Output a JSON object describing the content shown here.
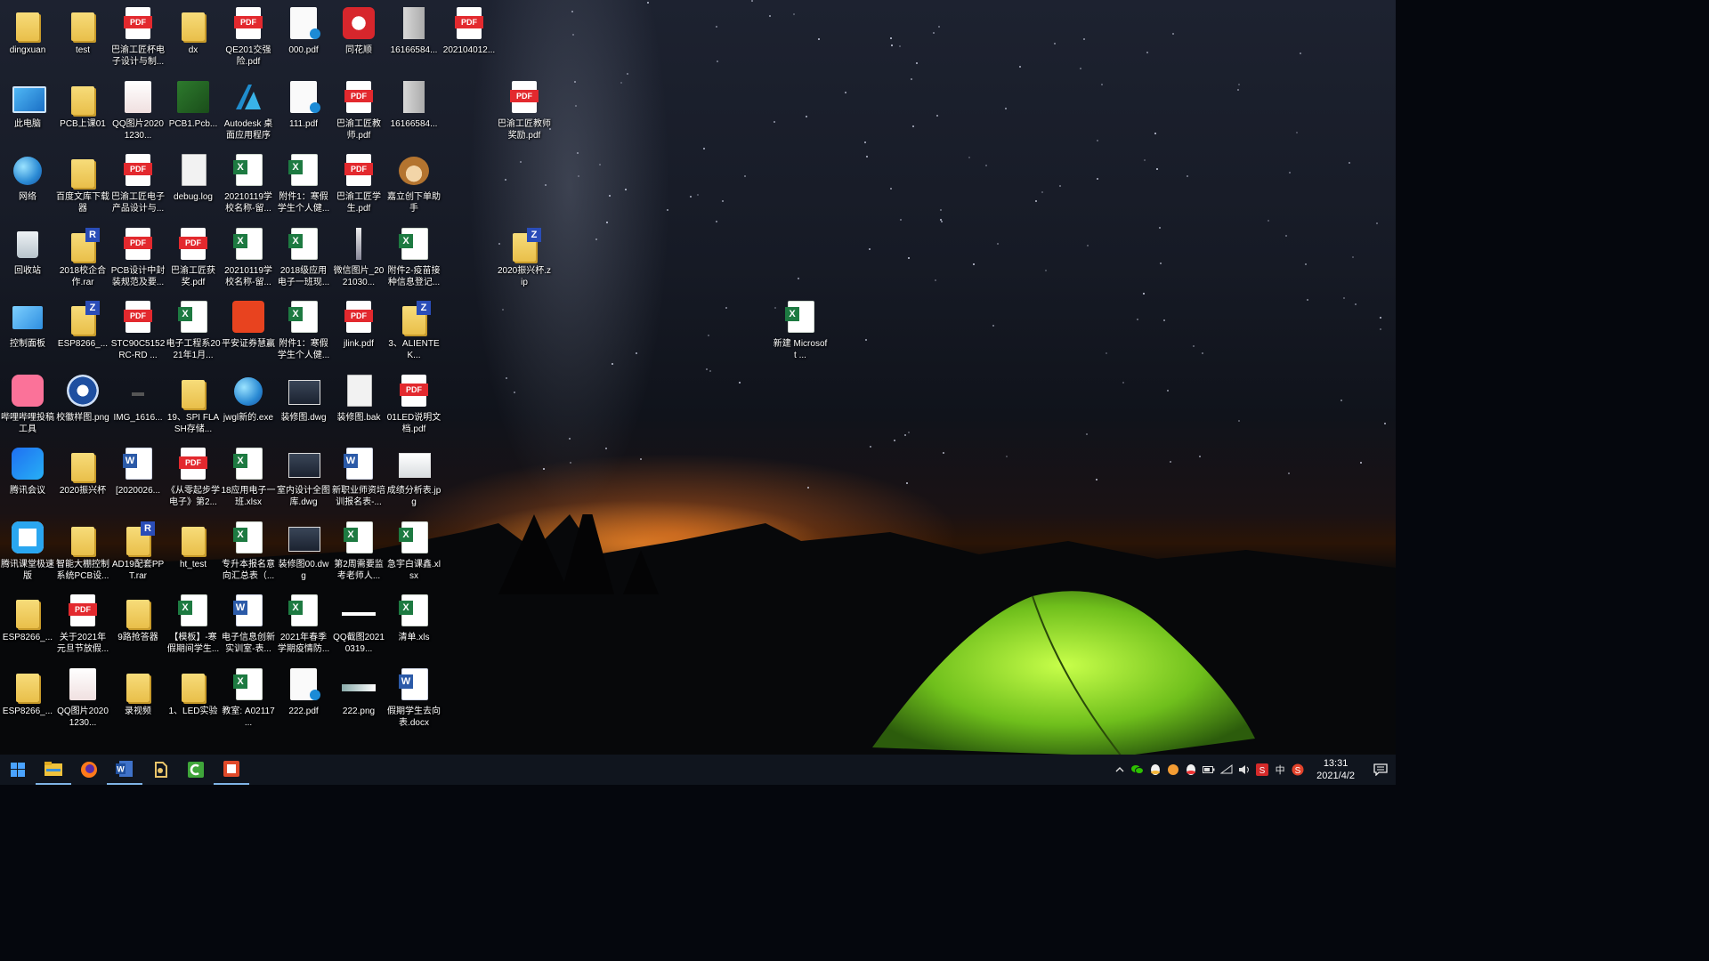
{
  "desktop": {
    "icons": [
      {
        "label": "dingxuan",
        "type": "user-folder",
        "icon": "user-folder-icon",
        "col": 0,
        "row": 0
      },
      {
        "label": "test",
        "type": "folder",
        "icon": "folder-icon",
        "col": 1,
        "row": 0
      },
      {
        "label": "巴渝工匠杯电子设计与制...",
        "type": "pdf",
        "icon": "pdf-icon",
        "col": 2,
        "row": 0
      },
      {
        "label": "dx",
        "type": "folder",
        "icon": "folder-icon",
        "col": 3,
        "row": 0
      },
      {
        "label": "QE201交强险.pdf",
        "type": "pdf",
        "icon": "pdf-icon",
        "col": 4,
        "row": 0
      },
      {
        "label": "000.pdf",
        "type": "edge-pdf",
        "icon": "edge-pdf-icon",
        "col": 5,
        "row": 0
      },
      {
        "label": "同花顺",
        "type": "app-red",
        "icon": "tonghuashun-icon",
        "col": 6,
        "row": 0
      },
      {
        "label": "16166584...",
        "type": "tall",
        "icon": "image-file-icon",
        "col": 7,
        "row": 0
      },
      {
        "label": "202104012...",
        "type": "pdf",
        "icon": "pdf-icon",
        "col": 8,
        "row": 0
      },
      {
        "label": "此电脑",
        "type": "pc",
        "icon": "this-pc-icon",
        "col": 0,
        "row": 1
      },
      {
        "label": "PCB上课01",
        "type": "folder",
        "icon": "folder-icon",
        "col": 1,
        "row": 1
      },
      {
        "label": "QQ图片20201230...",
        "type": "img-doc",
        "icon": "image-icon",
        "col": 2,
        "row": 1
      },
      {
        "label": "PCB1.Pcb...",
        "type": "pcb",
        "icon": "pcb-icon",
        "col": 3,
        "row": 1
      },
      {
        "label": "Autodesk 桌面应用程序",
        "type": "autodesk",
        "icon": "autodesk-icon",
        "col": 4,
        "row": 1
      },
      {
        "label": "111.pdf",
        "type": "edge-pdf",
        "icon": "edge-pdf-icon",
        "col": 5,
        "row": 1
      },
      {
        "label": "巴渝工匠教师.pdf",
        "type": "pdf",
        "icon": "pdf-icon",
        "col": 6,
        "row": 1
      },
      {
        "label": "16166584...",
        "type": "tall",
        "icon": "image-file-icon",
        "col": 7,
        "row": 1
      },
      {
        "label": "巴渝工匠教师奖励.pdf",
        "type": "pdf",
        "icon": "pdf-icon",
        "col": 9,
        "row": 1
      },
      {
        "label": "网络",
        "type": "globe",
        "icon": "network-icon",
        "col": 0,
        "row": 2
      },
      {
        "label": "百度文库下载器",
        "type": "folder",
        "icon": "folder-icon",
        "col": 1,
        "row": 2
      },
      {
        "label": "巴渝工匠电子产品设计与...",
        "type": "pdf",
        "icon": "pdf-icon",
        "col": 2,
        "row": 2
      },
      {
        "label": "debug.log",
        "type": "file",
        "icon": "text-file-icon",
        "col": 3,
        "row": 2
      },
      {
        "label": "20210119学校名称-留...",
        "type": "xls",
        "icon": "excel-icon",
        "col": 4,
        "row": 2
      },
      {
        "label": "附件1：寒假学生个人健...",
        "type": "xls",
        "icon": "excel-icon",
        "col": 5,
        "row": 2
      },
      {
        "label": "巴渝工匠学生.pdf",
        "type": "pdf",
        "icon": "pdf-icon",
        "col": 6,
        "row": 2
      },
      {
        "label": "嘉立创下单助手",
        "type": "bear",
        "icon": "jlc-bear-icon",
        "col": 7,
        "row": 2
      },
      {
        "label": "回收站",
        "type": "bin",
        "icon": "recycle-bin-icon",
        "col": 0,
        "row": 3
      },
      {
        "label": "2018校企合作.rar",
        "type": "rar",
        "icon": "rar-icon",
        "col": 1,
        "row": 3
      },
      {
        "label": "PCB设计中封装规范及要...",
        "type": "pdf",
        "icon": "pdf-icon",
        "col": 2,
        "row": 3
      },
      {
        "label": "巴渝工匠获奖.pdf",
        "type": "pdf",
        "icon": "pdf-icon",
        "col": 3,
        "row": 3
      },
      {
        "label": "20210119学校名称-留...",
        "type": "xls",
        "icon": "excel-icon",
        "col": 4,
        "row": 3
      },
      {
        "label": "2018级应用电子一班现...",
        "type": "xls",
        "icon": "excel-icon",
        "col": 5,
        "row": 3
      },
      {
        "label": "微信图片_2021030...",
        "type": "img-thin",
        "icon": "image-icon",
        "col": 6,
        "row": 3
      },
      {
        "label": "附件2-疫苗接种信息登记...",
        "type": "xls",
        "icon": "excel-icon",
        "col": 7,
        "row": 3
      },
      {
        "label": "2020振兴杯.zip",
        "type": "zip",
        "icon": "zip-icon",
        "col": 9,
        "row": 3
      },
      {
        "label": "控制面板",
        "type": "ctrl",
        "icon": "control-panel-icon",
        "col": 0,
        "row": 4
      },
      {
        "label": "ESP8266_...",
        "type": "zip",
        "icon": "zip-icon",
        "col": 1,
        "row": 4
      },
      {
        "label": "STC90C5152RC-RD ...",
        "type": "pdf",
        "icon": "pdf-icon",
        "col": 2,
        "row": 4
      },
      {
        "label": "电子工程系2021年1月...",
        "type": "xls",
        "icon": "excel-icon",
        "col": 3,
        "row": 4
      },
      {
        "label": "平安证券慧赢",
        "type": "pingan",
        "icon": "pingan-icon",
        "col": 4,
        "row": 4
      },
      {
        "label": "附件1：寒假学生个人健...",
        "type": "xls",
        "icon": "excel-icon",
        "col": 5,
        "row": 4
      },
      {
        "label": "jlink.pdf",
        "type": "pdf",
        "icon": "pdf-icon",
        "col": 6,
        "row": 4
      },
      {
        "label": "3、ALIENTEK...",
        "type": "zip",
        "icon": "zip-icon",
        "col": 7,
        "row": 4
      },
      {
        "label": "哔哩哔哩投稿工具",
        "type": "bili",
        "icon": "bilibili-icon",
        "col": 0,
        "row": 5
      },
      {
        "label": "校徽样图.png",
        "type": "badge",
        "icon": "school-badge-icon",
        "col": 1,
        "row": 5
      },
      {
        "label": "IMG_1616...",
        "type": "img-dark",
        "icon": "image-icon",
        "col": 2,
        "row": 5
      },
      {
        "label": "19、SPI FLASH存储...",
        "type": "folder",
        "icon": "folder-icon",
        "col": 3,
        "row": 5
      },
      {
        "label": "jwgl新的.exe",
        "type": "globe2",
        "icon": "exe-globe-icon",
        "col": 4,
        "row": 5
      },
      {
        "label": "装修图.dwg",
        "type": "dwg",
        "icon": "dwg-icon",
        "col": 5,
        "row": 5
      },
      {
        "label": "装修图.bak",
        "type": "file",
        "icon": "blank-file-icon",
        "col": 6,
        "row": 5
      },
      {
        "label": "01LED说明文档.pdf",
        "type": "pdf",
        "icon": "pdf-icon",
        "col": 7,
        "row": 5
      },
      {
        "label": "腾讯会议",
        "type": "meeting",
        "icon": "tencent-meeting-icon",
        "col": 0,
        "row": 6
      },
      {
        "label": "2020振兴杯",
        "type": "folder-lock",
        "icon": "folder-icon",
        "col": 1,
        "row": 6
      },
      {
        "label": "[2020026...",
        "type": "doc",
        "icon": "word-icon",
        "col": 2,
        "row": 6
      },
      {
        "label": "《从零起步学电子》第2...",
        "type": "pdf",
        "icon": "pdf-icon",
        "col": 3,
        "row": 6
      },
      {
        "label": "18应用电子一班.xlsx",
        "type": "xls",
        "icon": "excel-icon",
        "col": 4,
        "row": 6
      },
      {
        "label": "室内设计全图库.dwg",
        "type": "dwg",
        "icon": "dwg-icon",
        "col": 5,
        "row": 6
      },
      {
        "label": "新职业师资培训报名表-...",
        "type": "doc",
        "icon": "word-icon",
        "col": 6,
        "row": 6
      },
      {
        "label": "成绩分析表.jpg",
        "type": "jpg",
        "icon": "image-icon",
        "col": 7,
        "row": 6
      },
      {
        "label": "腾讯课堂极速版",
        "type": "classroom",
        "icon": "tencent-classroom-icon",
        "col": 0,
        "row": 7
      },
      {
        "label": "智能大棚控制系统PCB设...",
        "type": "folder",
        "icon": "folder-icon",
        "col": 1,
        "row": 7
      },
      {
        "label": "AD19配套PPT.rar",
        "type": "rar",
        "icon": "rar-icon",
        "col": 2,
        "row": 7
      },
      {
        "label": "ht_test",
        "type": "folder",
        "icon": "folder-icon",
        "col": 3,
        "row": 7
      },
      {
        "label": "专升本报名意向汇总表（...",
        "type": "xls",
        "icon": "excel-icon",
        "col": 4,
        "row": 7
      },
      {
        "label": "装修图00.dwg",
        "type": "dwg",
        "icon": "dwg-icon",
        "col": 5,
        "row": 7
      },
      {
        "label": "第2周需要监考老师人...",
        "type": "xls",
        "icon": "excel-icon",
        "col": 6,
        "row": 7
      },
      {
        "label": "急宇白课鑫.xlsx",
        "type": "xls",
        "icon": "excel-icon",
        "col": 7,
        "row": 7
      },
      {
        "label": "ESP8266_...",
        "type": "folder",
        "icon": "folder-icon",
        "col": 0,
        "row": 8
      },
      {
        "label": "关于2021年元旦节放假...",
        "type": "pdf",
        "icon": "pdf-icon",
        "col": 1,
        "row": 8
      },
      {
        "label": "9路抢答器",
        "type": "folder",
        "icon": "folder-icon",
        "col": 2,
        "row": 8
      },
      {
        "label": "【模板】-寒假期间学生...",
        "type": "xls",
        "icon": "excel-icon",
        "col": 3,
        "row": 8
      },
      {
        "label": "电子信息创新实训室-表...",
        "type": "doc",
        "icon": "word-icon",
        "col": 4,
        "row": 8
      },
      {
        "label": "2021年春季学期疫情防...",
        "type": "xls",
        "icon": "excel-icon",
        "col": 5,
        "row": 8
      },
      {
        "label": "QQ截图20210319...",
        "type": "line",
        "icon": "screenshot-icon",
        "col": 6,
        "row": 8
      },
      {
        "label": "清单.xls",
        "type": "xls",
        "icon": "excel-icon",
        "col": 7,
        "row": 8
      },
      {
        "label": "ESP8266_...",
        "type": "folder",
        "icon": "folder-icon",
        "col": 0,
        "row": 9
      },
      {
        "label": "QQ图片20201230...",
        "type": "img-doc",
        "icon": "image-icon",
        "col": 1,
        "row": 9
      },
      {
        "label": "录视频",
        "type": "folder",
        "icon": "folder-icon",
        "col": 2,
        "row": 9
      },
      {
        "label": "1、LED实验",
        "type": "folder",
        "icon": "folder-icon",
        "col": 3,
        "row": 9
      },
      {
        "label": "教室: A02117 ...",
        "type": "xls",
        "icon": "excel-icon",
        "col": 4,
        "row": 9
      },
      {
        "label": "222.pdf",
        "type": "edge-pdf",
        "icon": "edge-pdf-icon",
        "col": 5,
        "row": 9
      },
      {
        "label": "222.png",
        "type": "strip",
        "icon": "image-icon",
        "col": 6,
        "row": 9
      },
      {
        "label": "假期学生去向表.docx",
        "type": "doc",
        "icon": "word-icon",
        "col": 7,
        "row": 9
      },
      {
        "label": "新建 Microsoft ...",
        "type": "xls",
        "icon": "excel-icon",
        "col": 14,
        "row": 4
      }
    ]
  },
  "taskbar": {
    "apps": [
      {
        "name": "start-button",
        "icon": "windows-icon"
      },
      {
        "name": "file-explorer-button",
        "icon": "folder-icon"
      },
      {
        "name": "firefox-button",
        "icon": "firefox-icon"
      },
      {
        "name": "word-button",
        "icon": "word-icon"
      },
      {
        "name": "app-button-1",
        "icon": "app-icon"
      },
      {
        "name": "app-button-2",
        "icon": "app-icon"
      },
      {
        "name": "app-button-3",
        "icon": "app-icon"
      }
    ],
    "tray": {
      "ime": "中",
      "time": "13:31",
      "date": "2021/4/2"
    }
  },
  "colors": {
    "taskbar_bg": "#10151e",
    "pdf_red": "#e3292e",
    "excel_green": "#1d7a41",
    "word_blue": "#2b5aa8",
    "folder_yellow": "#f0cf62"
  }
}
